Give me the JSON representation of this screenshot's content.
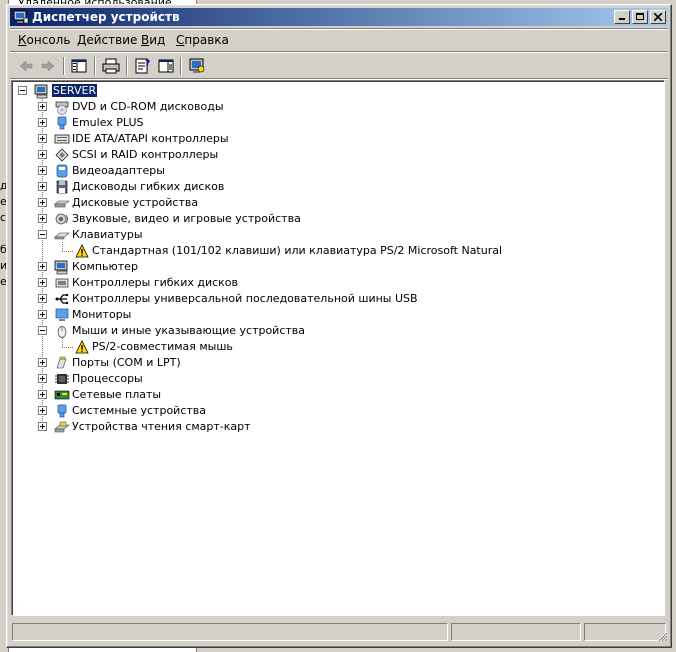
{
  "background_window": {
    "clipped_text": "Удаленное использование",
    "edge_chars": [
      "д",
      "е",
      "с",
      "",
      "б",
      "и",
      "е",
      "",
      "",
      "",
      "",
      "",
      "",
      "",
      "",
      "",
      ""
    ]
  },
  "window": {
    "title": "Диспетчер устройств",
    "buttons": {
      "minimize": "_",
      "maximize": "□",
      "close": "✕"
    }
  },
  "menu": [
    {
      "label": "Консоль",
      "ul": "К",
      "rest": "онсоль"
    },
    {
      "label": "Действие",
      "ul": "Д",
      "rest": "ействие"
    },
    {
      "label": "Вид",
      "ul": "В",
      "rest": "ид"
    },
    {
      "label": "Справка",
      "ul": "С",
      "rest": "правка"
    }
  ],
  "toolbar": {
    "items": [
      "back-icon",
      "forward-icon",
      "show-hide-tree-icon",
      "print-icon",
      "properties-icon",
      "help-pane-icon",
      "scan-hardware-icon"
    ]
  },
  "tree": {
    "root": "SERVER",
    "items": [
      {
        "label": "DVD и CD-ROM дисководы",
        "icon": "cdrom-icon",
        "expanded": false
      },
      {
        "label": "Emulex PLUS",
        "icon": "device-icon",
        "expanded": false
      },
      {
        "label": "IDE ATA/ATAPI контроллеры",
        "icon": "ide-controller-icon",
        "expanded": false
      },
      {
        "label": "SCSI и RAID контроллеры",
        "icon": "scsi-controller-icon",
        "expanded": false
      },
      {
        "label": "Видеоадаптеры",
        "icon": "display-adapter-icon",
        "expanded": false
      },
      {
        "label": "Дисководы гибких дисков",
        "icon": "floppy-drive-icon",
        "expanded": false
      },
      {
        "label": "Дисковые устройства",
        "icon": "disk-drive-icon",
        "expanded": false
      },
      {
        "label": "Звуковые, видео и игровые устройства",
        "icon": "sound-icon",
        "expanded": false
      },
      {
        "label": "Клавиатуры",
        "icon": "keyboard-icon",
        "expanded": true,
        "children": [
          {
            "label": "Стандартная (101/102 клавиши) или клавиатура PS/2 Microsoft Natural",
            "icon": "warning-icon"
          }
        ]
      },
      {
        "label": "Компьютер",
        "icon": "computer-icon",
        "expanded": false
      },
      {
        "label": "Контроллеры гибких дисков",
        "icon": "floppy-controller-icon",
        "expanded": false
      },
      {
        "label": "Контроллеры универсальной последовательной шины USB",
        "icon": "usb-icon",
        "expanded": false
      },
      {
        "label": "Мониторы",
        "icon": "monitor-icon",
        "expanded": false
      },
      {
        "label": "Мыши и иные указывающие устройства",
        "icon": "mouse-icon",
        "expanded": true,
        "children": [
          {
            "label": "PS/2-совместимая мышь",
            "icon": "warning-icon"
          }
        ]
      },
      {
        "label": "Порты (COM и LPT)",
        "icon": "port-icon",
        "expanded": false
      },
      {
        "label": "Процессоры",
        "icon": "processor-icon",
        "expanded": false
      },
      {
        "label": "Сетевые платы",
        "icon": "network-card-icon",
        "expanded": false
      },
      {
        "label": "Системные устройства",
        "icon": "system-device-icon",
        "expanded": false
      },
      {
        "label": "Устройства чтения смарт-карт",
        "icon": "smartcard-reader-icon",
        "expanded": false
      }
    ]
  },
  "colors": {
    "title_start": "#0a246a",
    "title_end": "#a6caf0",
    "chrome": "#d4d0c8",
    "selection": "#0a246a",
    "warning": "#ffd800"
  }
}
